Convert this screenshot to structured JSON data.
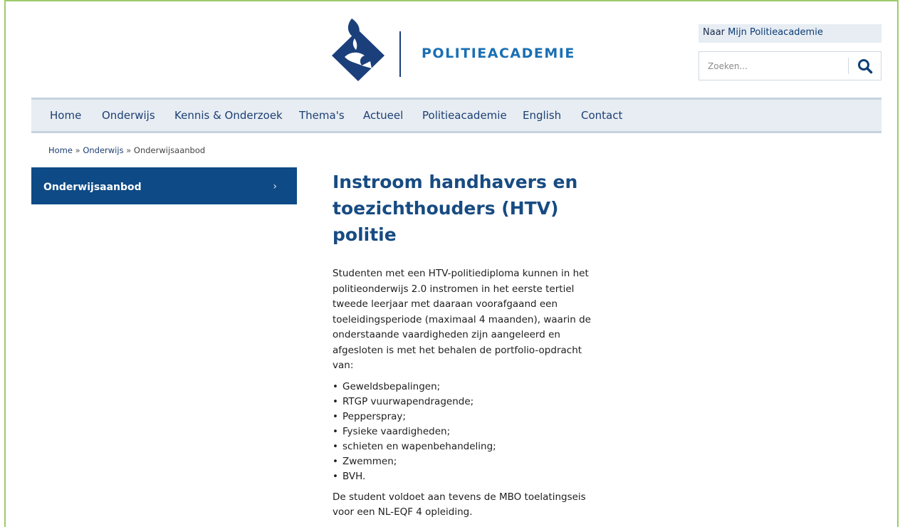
{
  "header": {
    "logo_text": "POLITIEACADEMIE",
    "mijn_prefix": "Naar ",
    "mijn_label": "Mijn Politieacademie",
    "search": {
      "placeholder": "Zoeken...",
      "button_icon": "search-icon"
    }
  },
  "nav": {
    "items": [
      {
        "label": "Home"
      },
      {
        "label": "Onderwijs"
      },
      {
        "label": "Kennis & Onderzoek"
      },
      {
        "label": "Thema's"
      },
      {
        "label": "Actueel"
      },
      {
        "label": "Politieacademie"
      },
      {
        "label": "English"
      },
      {
        "label": "Contact"
      }
    ]
  },
  "breadcrumb": {
    "items": [
      "Home",
      "Onderwijs",
      "Onderwijsaanbod"
    ],
    "separator": "»"
  },
  "sidebar": {
    "items": [
      {
        "label": "Onderwijsaanbod",
        "chevron": "›"
      }
    ]
  },
  "main": {
    "title": "Instroom handhavers en toezichthouders (HTV) politie",
    "intro": "Studenten met een HTV-politiediploma kunnen in het politieonderwijs 2.0 instromen in het eerste tertiel tweede leerjaar met daaraan voorafgaand een toeleidingsperiode (maximaal 4 maanden), waarin de onderstaande vaardigheden zijn aangeleerd en afgesloten is met het behalen de portfolio-opdracht van:",
    "list": [
      "Geweldsbepalingen;",
      "RTGP vuurwapendragende;",
      "Pepperspray;",
      "Fysieke vaardigheden;",
      "schieten en wapenbehandeling;",
      "Zwemmen;",
      "BVH."
    ],
    "outro": "De student voldoet aan tevens de MBO toelatingseis voor een NL-EQF 4 opleiding."
  },
  "colors": {
    "brand_dark": "#0e4a85",
    "brand_blue": "#1a6fb4",
    "nav_bg": "#e7edf3",
    "frame_green": "#9ecb6b"
  }
}
